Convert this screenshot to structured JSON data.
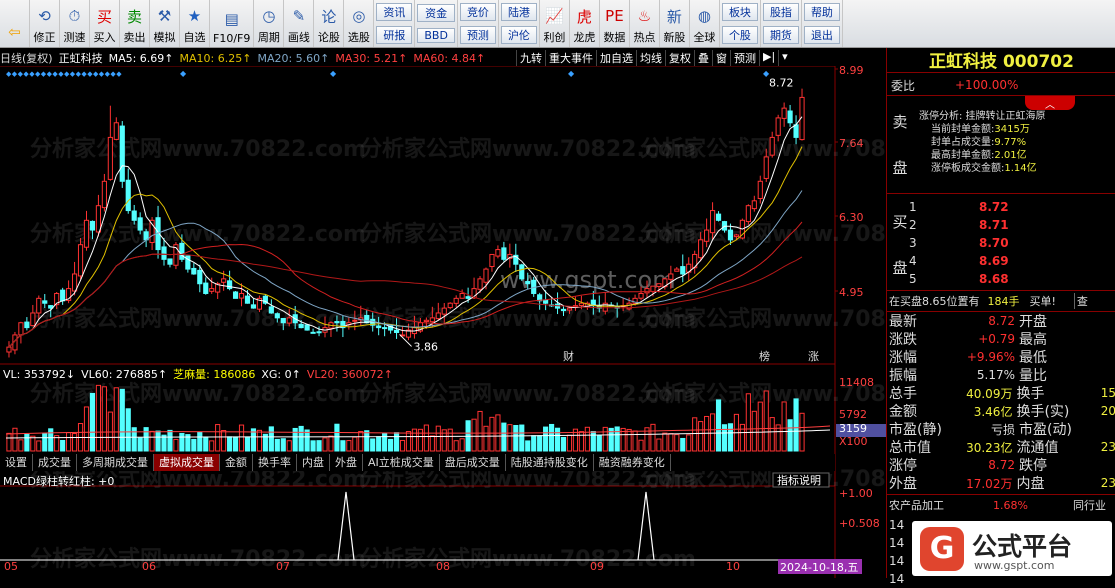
{
  "toolbar": {
    "items": [
      {
        "label": "",
        "icon": "back-arrow-icon"
      },
      {
        "label": "修正",
        "icon": "fix-icon"
      },
      {
        "label": "测速",
        "icon": "speed-icon"
      },
      {
        "label": "买入",
        "icon": "buy-icon"
      },
      {
        "label": "卖出",
        "icon": "sell-icon"
      },
      {
        "label": "模拟",
        "icon": "hammer-icon"
      },
      {
        "label": "自选",
        "icon": "star-icon"
      },
      {
        "label": "F10/F9",
        "icon": "f10-icon"
      },
      {
        "label": "周期",
        "icon": "clock-icon"
      },
      {
        "label": "画线",
        "icon": "pen-icon"
      },
      {
        "label": "论股",
        "icon": "comment-icon"
      },
      {
        "label": "选股",
        "icon": "select-icon"
      }
    ],
    "pairs": [
      [
        "资讯",
        "研报"
      ],
      [
        "资金",
        "BBD"
      ],
      [
        "竞价",
        "预测"
      ],
      [
        "陆港",
        "沪伦"
      ]
    ],
    "items2": [
      {
        "label": "利创",
        "icon": "chart-icon"
      },
      {
        "label": "龙虎",
        "icon": "tiger-icon"
      },
      {
        "label": "数据",
        "icon": "pe-icon"
      },
      {
        "label": "热点",
        "icon": "hot-icon"
      },
      {
        "label": "新股",
        "icon": "new-icon"
      },
      {
        "label": "全球",
        "icon": "globe-icon"
      }
    ],
    "pairs2": [
      [
        "板块",
        "个股"
      ],
      [
        "股指",
        "期货"
      ],
      [
        "帮助",
        "退出"
      ]
    ]
  },
  "chart_header": {
    "mode": "日线(复权)",
    "name": "正虹科技",
    "ma5": "MA5: 6.69↑",
    "ma10": "MA10: 6.25↑",
    "ma20": "MA20: 5.60↑",
    "ma30": "MA30: 5.21↑",
    "ma60": "MA60: 4.84↑"
  },
  "chart_tools": [
    "九转",
    "重大事件",
    "加自选",
    "均线",
    "复权",
    "叠",
    "窗",
    "预测"
  ],
  "price_axis": [
    "8.99",
    "7.64",
    "6.30",
    "4.95"
  ],
  "price_labels": {
    "high": "8.72",
    "low": "3.86"
  },
  "markers": {
    "cai": "财",
    "bang": "榜",
    "zhang": "涨"
  },
  "volume_header": {
    "vl": "VL: 353792↓",
    "vl60": "VL60: 276885↑",
    "zhima": "芝麻量: 186086",
    "xg": "XG: 0↑",
    "vl20": "VL20: 360072↑"
  },
  "volume_axis": [
    "11408",
    "5792",
    "3159",
    "X100"
  ],
  "bottom_tabs": [
    "设置",
    "成交量",
    "多周期成交量",
    "虚拟成交量",
    "金额",
    "换手率",
    "内盘",
    "外盘",
    "AI立桩成交量",
    "盘后成交量",
    "陆股通持股变化",
    "融资融券变化"
  ],
  "active_tab": "虚拟成交量",
  "macd": {
    "title": "MACD绿柱转红柱: +0",
    "button": "指标说明",
    "axis": [
      "+1.00",
      "+0.508"
    ]
  },
  "date_axis": [
    "05",
    "06",
    "07",
    "08",
    "09",
    "10"
  ],
  "date_highlight": "2024-10-18,五",
  "panel": {
    "title": "正虹科技 000702",
    "weibi_label": "委比",
    "weibi_value": "+100.00%",
    "limit_analysis": "涨停分析: 挂牌转让正虹海原",
    "limit_lines": [
      {
        "k": "当前封单金额:",
        "v": "3415万"
      },
      {
        "k": "封单占成交量:",
        "v": "9.77%"
      },
      {
        "k": "最高封单金额:",
        "v": "2.01亿"
      },
      {
        "k": "涨停板成交金额:",
        "v": "1.14亿"
      }
    ],
    "sell_label": [
      "卖",
      "盘"
    ],
    "buy_label": [
      "买",
      "盘"
    ],
    "buy_orders": [
      {
        "n": "1",
        "p": "8.72"
      },
      {
        "n": "2",
        "p": "8.71"
      },
      {
        "n": "3",
        "p": "8.70"
      },
      {
        "n": "4",
        "p": "8.69"
      },
      {
        "n": "5",
        "p": "8.68"
      }
    ],
    "order_line": {
      "a": "在买盘",
      "b": "8.65位置有",
      "c": "184手",
      "d": "买单!",
      "e": "查"
    },
    "stats": [
      {
        "k1": "最新",
        "v1": "8.72",
        "k2": "开盘",
        "v2": ""
      },
      {
        "k1": "涨跌",
        "v1": "+0.79",
        "k2": "最高",
        "v2": ""
      },
      {
        "k1": "涨幅",
        "v1": "+9.96%",
        "k2": "最低",
        "v2": ""
      },
      {
        "k1": "振幅",
        "v1": "5.17%",
        "k2": "量比",
        "v2": ""
      },
      {
        "k1": "总手",
        "v1": "40.09万",
        "k2": "换手",
        "v2": "15"
      },
      {
        "k1": "金额",
        "v1": "3.46亿",
        "k2": "换手(实)",
        "v2": "20"
      },
      {
        "k1": "市盈(静)",
        "v1": "亏损",
        "k2": "市盈(动)",
        "v2": ""
      },
      {
        "k1": "总市值",
        "v1": "30.23亿",
        "k2": "流通值",
        "v2": "23"
      },
      {
        "k1": "涨停",
        "v1": "8.72",
        "k2": "跌停",
        "v2": ""
      },
      {
        "k1": "外盘",
        "v1": "17.02万",
        "k2": "内盘",
        "v2": "23"
      }
    ],
    "industry": {
      "name": "农产品加工",
      "pct": "1.68%",
      "right": "同行业"
    },
    "ticks": [
      "14",
      "14",
      "14",
      "14"
    ]
  },
  "brand": {
    "text": "公式平台",
    "url_text": "www.gspt.com",
    "logo_letter": "G"
  },
  "watermarks": {
    "a": "分析家公式网www.70822.com",
    "b": "www.gspt.com"
  },
  "chart_data": {
    "type": "candlestick",
    "title": "",
    "ylim": [
      3.5,
      9.2
    ],
    "closes": [
      3.6,
      3.85,
      4.1,
      4.0,
      4.3,
      4.6,
      4.5,
      4.4,
      4.7,
      4.55,
      4.8,
      5.1,
      5.7,
      6.2,
      6.0,
      6.5,
      7.0,
      7.9,
      8.2,
      7.0,
      6.4,
      6.2,
      6.0,
      5.8,
      6.2,
      5.6,
      5.4,
      5.3,
      5.7,
      5.4,
      5.2,
      5.1,
      4.9,
      4.7,
      4.8,
      4.9,
      5.0,
      4.8,
      4.6,
      4.7,
      4.5,
      4.4,
      4.6,
      4.5,
      4.3,
      4.2,
      4.1,
      4.2,
      4.1,
      4.0,
      3.95,
      3.9,
      3.9,
      4.0,
      4.1,
      4.1,
      4.0,
      4.1,
      4.15,
      4.2,
      4.1,
      4.05,
      4.0,
      4.0,
      3.95,
      3.9,
      3.85,
      3.95,
      4.0,
      4.1,
      4.15,
      4.2,
      4.3,
      4.4,
      4.5,
      4.6,
      4.7,
      4.6,
      4.8,
      5.0,
      5.2,
      5.5,
      5.6,
      5.4,
      5.5,
      5.3,
      5.0,
      4.9,
      4.7,
      4.55,
      4.5,
      4.45,
      4.4,
      4.35,
      4.4,
      4.45,
      4.5,
      4.5,
      4.45,
      4.4,
      4.5,
      4.45,
      4.4,
      4.45,
      4.5,
      4.6,
      4.7,
      4.8,
      4.85,
      4.9,
      5.0,
      5.1,
      5.2,
      5.1,
      5.3,
      5.5,
      5.8,
      6.0,
      6.4,
      6.2,
      6.0,
      5.8,
      5.9,
      6.2,
      6.5,
      6.6,
      7.0,
      7.5,
      7.9,
      8.3,
      8.5,
      8.2,
      7.9,
      8.72
    ]
  }
}
